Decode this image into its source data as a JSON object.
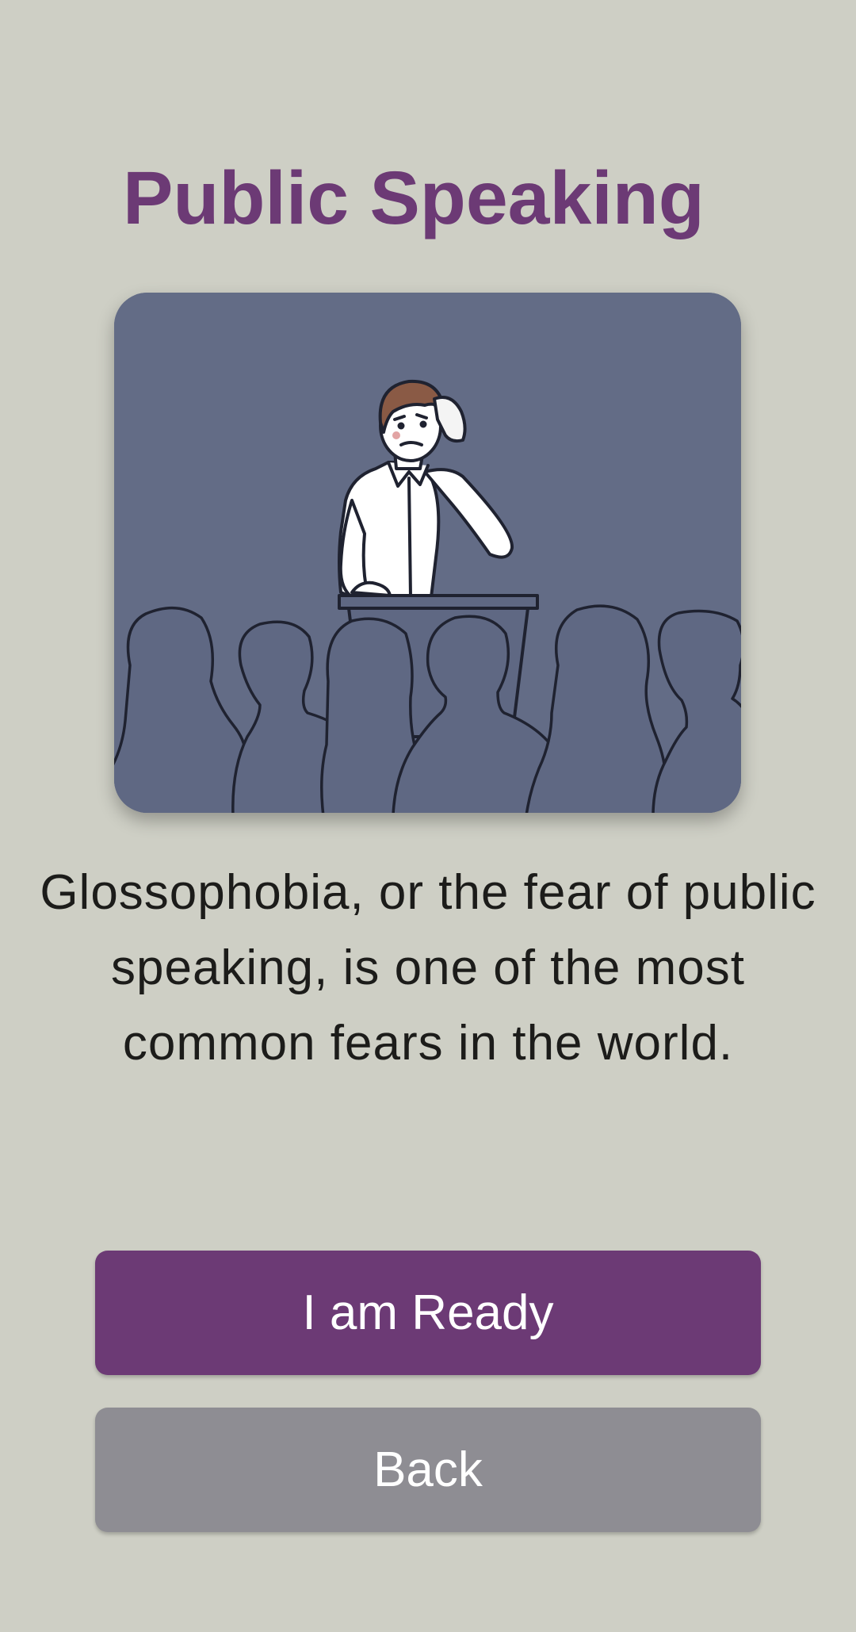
{
  "page": {
    "title": "Public Speaking",
    "description": "Glossophobia, or the fear of public speaking, is one of the most common fears in the world."
  },
  "illustration": {
    "subject": "nervous speaker at podium wiping sweat in front of audience",
    "background_color": "#636c86"
  },
  "actions": {
    "primary_label": "I am Ready",
    "secondary_label": "Back"
  },
  "colors": {
    "background": "#cecfc5",
    "accent": "#6c3a75",
    "secondary_button": "#8e8d93",
    "text": "#1c1c1a"
  }
}
